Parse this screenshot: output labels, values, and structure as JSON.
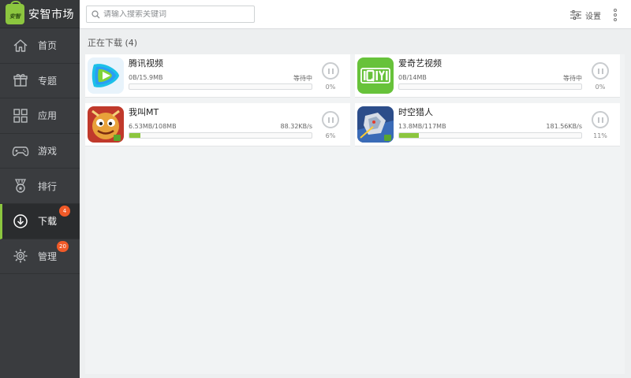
{
  "brand": {
    "name": "安智市场",
    "logo_text": "安智"
  },
  "search": {
    "placeholder": "请输入搜索关键词"
  },
  "topbar": {
    "settings_label": "设置"
  },
  "sidebar": {
    "items": [
      {
        "label": "首页",
        "icon": "home-icon"
      },
      {
        "label": "专题",
        "icon": "gift-icon"
      },
      {
        "label": "应用",
        "icon": "grid-icon"
      },
      {
        "label": "游戏",
        "icon": "gamepad-icon"
      },
      {
        "label": "排行",
        "icon": "medal-icon"
      },
      {
        "label": "下载",
        "icon": "download-icon",
        "badge": "4",
        "active": true
      },
      {
        "label": "管理",
        "icon": "gear-icon",
        "badge": "20"
      }
    ]
  },
  "downloads": {
    "section_title": "正在下载 (4)",
    "items": [
      {
        "name": "腾讯视频",
        "size": "0B/15.9MB",
        "status": "等待中",
        "percent": "0%",
        "progress": 0
      },
      {
        "name": "爱奇艺视频",
        "size": "0B/14MB",
        "status": "等待中",
        "percent": "0%",
        "progress": 0
      },
      {
        "name": "我叫MT",
        "size": "6.53MB/108MB",
        "status": "88.32KB/s",
        "percent": "6%",
        "progress": 6
      },
      {
        "name": "时空猎人",
        "size": "13.8MB/117MB",
        "status": "181.56KB/s",
        "percent": "11%",
        "progress": 11
      }
    ]
  },
  "colors": {
    "accent": "#8cc63f",
    "badge": "#f05a28",
    "sidebar": "#3a3c3f"
  }
}
